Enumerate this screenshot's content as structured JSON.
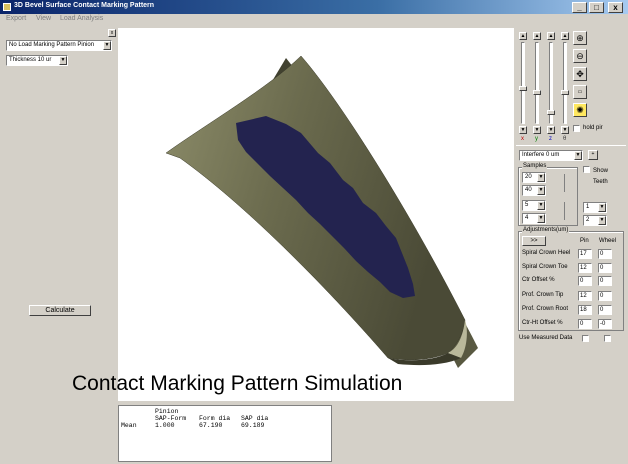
{
  "window": {
    "title": "3D Bevel Surface Contact Marking Pattern",
    "minimize": "_",
    "maximize": "□",
    "close": "x"
  },
  "menu": [
    "Export",
    "View",
    "Load Analysis"
  ],
  "left_panel": {
    "close": "x",
    "pattern_select": "No Load Marking Pattern Pinion",
    "thickness_select": "Thickness 10 ur",
    "calculate": "Calculate"
  },
  "caption": "Contact Marking Pattern Simulation",
  "results": {
    "header1": "Pinion",
    "columns": [
      "SAP-Form",
      "Form dia",
      "SAP dia"
    ],
    "row_label": "Mean",
    "row_values": [
      "1.000",
      "67.190",
      "69.189"
    ]
  },
  "right_panel": {
    "axis_labels": [
      "x",
      "y",
      "z",
      "θ"
    ],
    "hold_label": "hold pir",
    "interference_select": "Interfere 0 um",
    "samples_label": "Samples",
    "samples": [
      "20",
      "40",
      "5",
      "4"
    ],
    "show_teeth_label": "Show Teeth",
    "teeth_selects": [
      "1",
      "2"
    ],
    "adjustments_label": "Adjustments(um)",
    "go_button": ">>",
    "col_pin": "Pin",
    "col_wheel": "Wheel",
    "adjust_rows": [
      {
        "label": "Spiral Crown Heel",
        "pin": "17",
        "wheel": "0"
      },
      {
        "label": "Spiral Crown Toe",
        "pin": "12",
        "wheel": "0"
      },
      {
        "label": "Ctr Offset %",
        "pin": "0",
        "wheel": "0"
      },
      {
        "label": "Prof. Crown Tip",
        "pin": "12",
        "wheel": "0"
      },
      {
        "label": "Prof. Crown Root",
        "pin": "18",
        "wheel": "0"
      },
      {
        "label": "Ctr-Ht Offset %",
        "pin": "0",
        "wheel": "-0"
      }
    ],
    "use_measured": "Use Measured Data"
  },
  "colors": {
    "tooth_surface": "#6b6b4e",
    "contact_pattern": "#23234f"
  }
}
